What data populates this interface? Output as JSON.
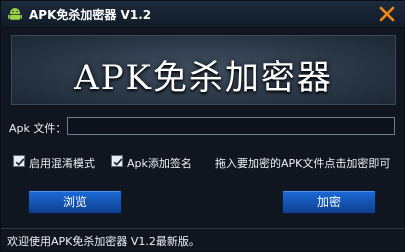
{
  "window": {
    "title": "APK免杀加密器 V1.2"
  },
  "banner": {
    "title": "APK免杀加密器"
  },
  "file_row": {
    "label": "Apk 文件：",
    "value": "",
    "placeholder": ""
  },
  "options": [
    {
      "label": "启用混淆模式",
      "checked": true
    },
    {
      "label": "Apk添加签名",
      "checked": true
    }
  ],
  "hint": "拖入要加密的APK文件点击加密即可",
  "buttons": {
    "browse": "浏览",
    "encrypt": "加密"
  },
  "status": "欢迎使用APK免杀加密器 V1.2最新版。",
  "icons": {
    "app": "android-icon",
    "close": "close-icon",
    "check": "checkmark-icon"
  },
  "colors": {
    "window_bg": "#0f1620",
    "button_blue": "#1b6bd8",
    "close_orange": "#f08a18"
  }
}
